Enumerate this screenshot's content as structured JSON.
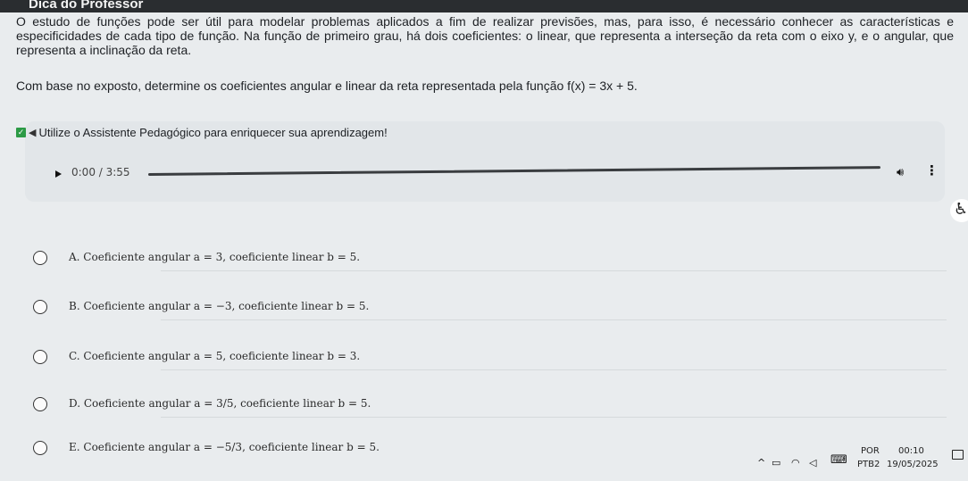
{
  "header": {
    "title": "Dica do Professor"
  },
  "question": {
    "paragraph1": "O estudo de funções pode ser útil para modelar problemas aplicados a fim de realizar previsões, mas, para isso, é necessário conhecer as características e especificidades de cada tipo de função. Na função de primeiro grau, há dois coeficientes: o linear, que representa a interseção da reta com o eixo y, e o angular, que representa a inclinação da reta.",
    "paragraph2": "Com base no exposto, determine os coeficientes angular e linear da reta representada pela função f(x) = 3x + 5."
  },
  "assistant": {
    "label": "Utilize o Assistente Pedagógico para enriquecer sua aprendizagem!",
    "check_icon": "check-icon",
    "speaker_icon": "speaker-icon"
  },
  "audio": {
    "time": "0:00 / 3:55",
    "progress": 0.0,
    "play_icon": "play-icon",
    "volume_icon": "volume-icon",
    "more_icon": "more-vertical-icon"
  },
  "options": [
    {
      "label": "A. Coeficiente angular a = 3, coeficiente linear b = 5."
    },
    {
      "label": "B. Coeficiente angular a = −3, coeficiente linear b = 5."
    },
    {
      "label": "C. Coeficiente angular a = 5, coeficiente linear b = 3."
    },
    {
      "label": "D. Coeficiente angular a = 3/5, coeficiente linear b = 5."
    },
    {
      "label": "E. Coeficiente angular a = −5/3, coeficiente linear b = 5."
    }
  ],
  "taskbar": {
    "lang_top": "POR",
    "lang_bottom": "PTB2",
    "time": "00:10",
    "date": "19/05/2025"
  },
  "colors": {
    "accent_check": "#2c9a45",
    "page_bg": "#e9ecee"
  }
}
